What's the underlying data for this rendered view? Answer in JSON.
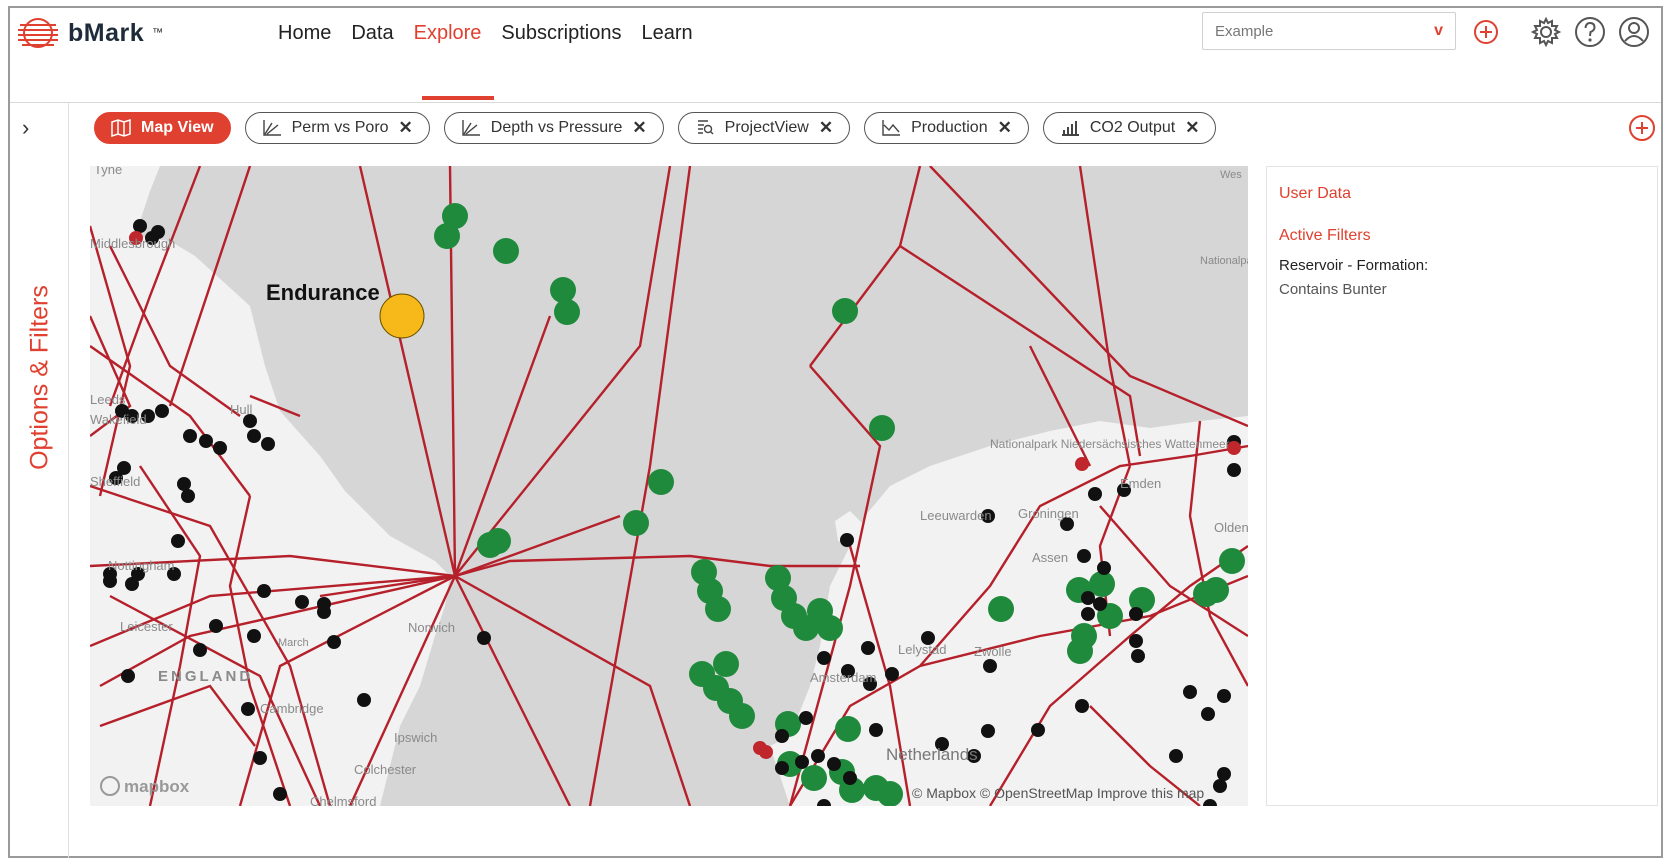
{
  "app": {
    "name": "bMark",
    "trademark": "™"
  },
  "nav": {
    "items": [
      "Home",
      "Data",
      "Explore",
      "Subscriptions",
      "Learn"
    ],
    "active": "Explore"
  },
  "search": {
    "value": "Example",
    "chevron": "v"
  },
  "sidebar": {
    "label": "Options & Filters"
  },
  "tabs": [
    {
      "label": "Map View",
      "icon": "map-icon",
      "active": true,
      "closable": false
    },
    {
      "label": "Perm vs Poro",
      "icon": "scatter-chart-icon",
      "active": false,
      "closable": true
    },
    {
      "label": "Depth vs Pressure",
      "icon": "scatter-chart-icon",
      "active": false,
      "closable": true
    },
    {
      "label": "ProjectView",
      "icon": "document-search-icon",
      "active": false,
      "closable": true
    },
    {
      "label": "Production",
      "icon": "line-chart-icon",
      "active": false,
      "closable": true
    },
    {
      "label": "CO2 Output",
      "icon": "bar-chart-icon",
      "active": false,
      "closable": true
    }
  ],
  "map": {
    "highlight_label": "Endurance",
    "place_labels": [
      "Tyne",
      "Middlesbrough",
      "Leeds",
      "Wakefield",
      "Sheffield",
      "Nottingham",
      "Leicester",
      "ENGLAND",
      "Cambridge",
      "Ipswich",
      "Colchester",
      "Chelmsford",
      "Hull",
      "Norwich",
      "March",
      "Amsterdam",
      "Leeuwarden",
      "Groningen",
      "Assen",
      "Lelystad",
      "Zwolle",
      "Netherlands",
      "Emden",
      "Oldenburg",
      "Nationalpark Niedersächsisches Wattenmeer",
      "Nationalpark Hamburgisches Wattenmeer",
      "Wes"
    ],
    "attribution": "© Mapbox © OpenStreetMap  Improve this map",
    "brand": "mapbox",
    "colors": {
      "pipeline": "#b5202a",
      "green_site": "#1f8a3c",
      "black_site": "#111111",
      "red_site": "#c0272d",
      "highlight": "#f7b91a",
      "sea": "#d6d6d6",
      "land": "#f2f2f2"
    }
  },
  "panel": {
    "user_data": "User Data",
    "active_filters": "Active Filters",
    "filter_name": "Reservoir - Formation:",
    "filter_value": "Contains Bunter"
  }
}
